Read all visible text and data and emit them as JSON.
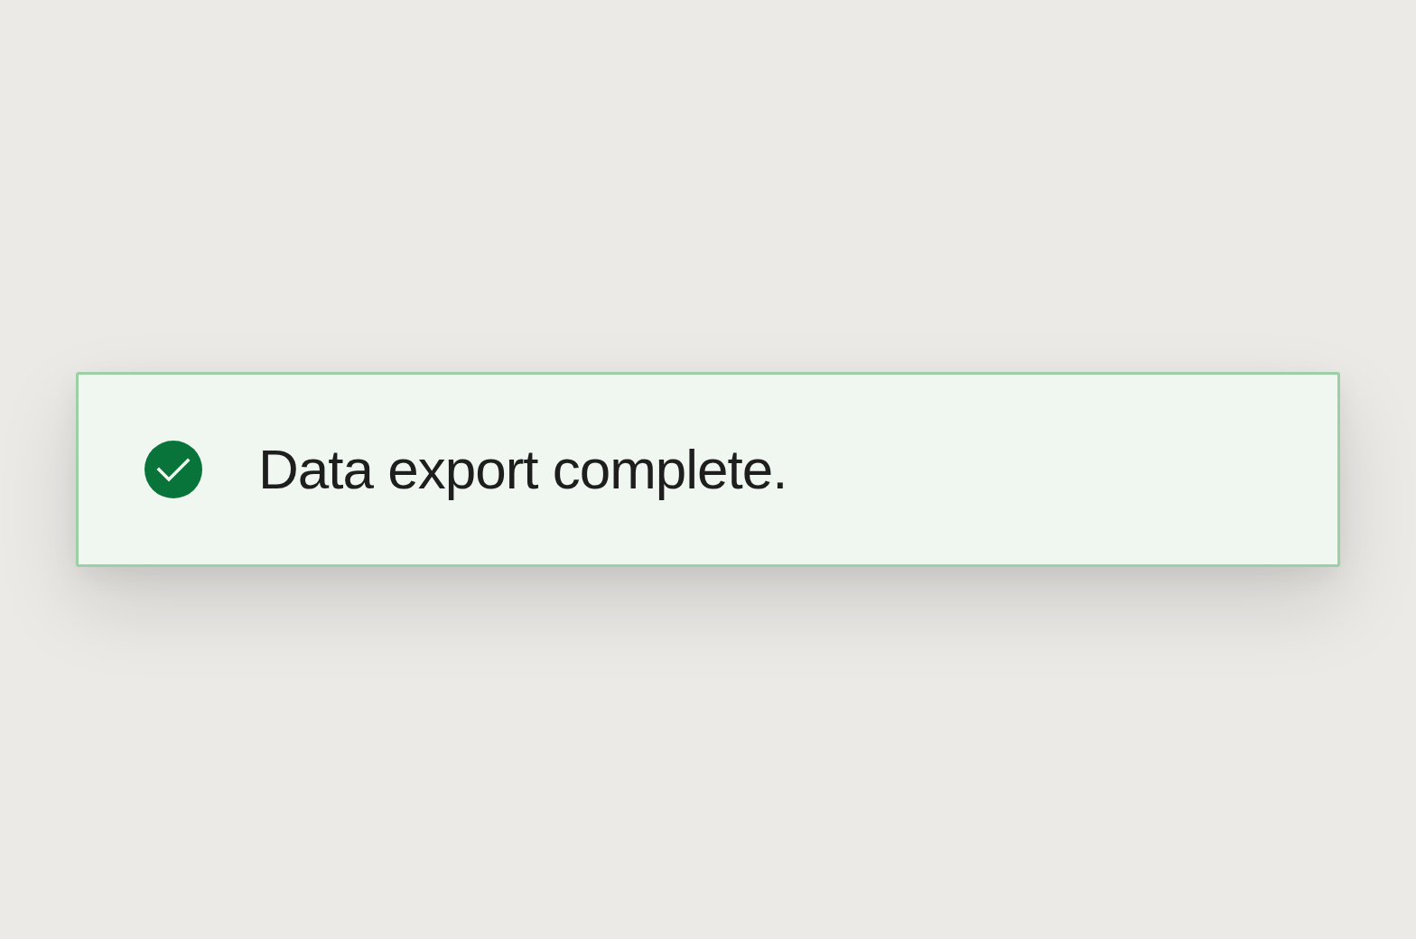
{
  "toast": {
    "kind": "success",
    "message": "Data export complete."
  }
}
